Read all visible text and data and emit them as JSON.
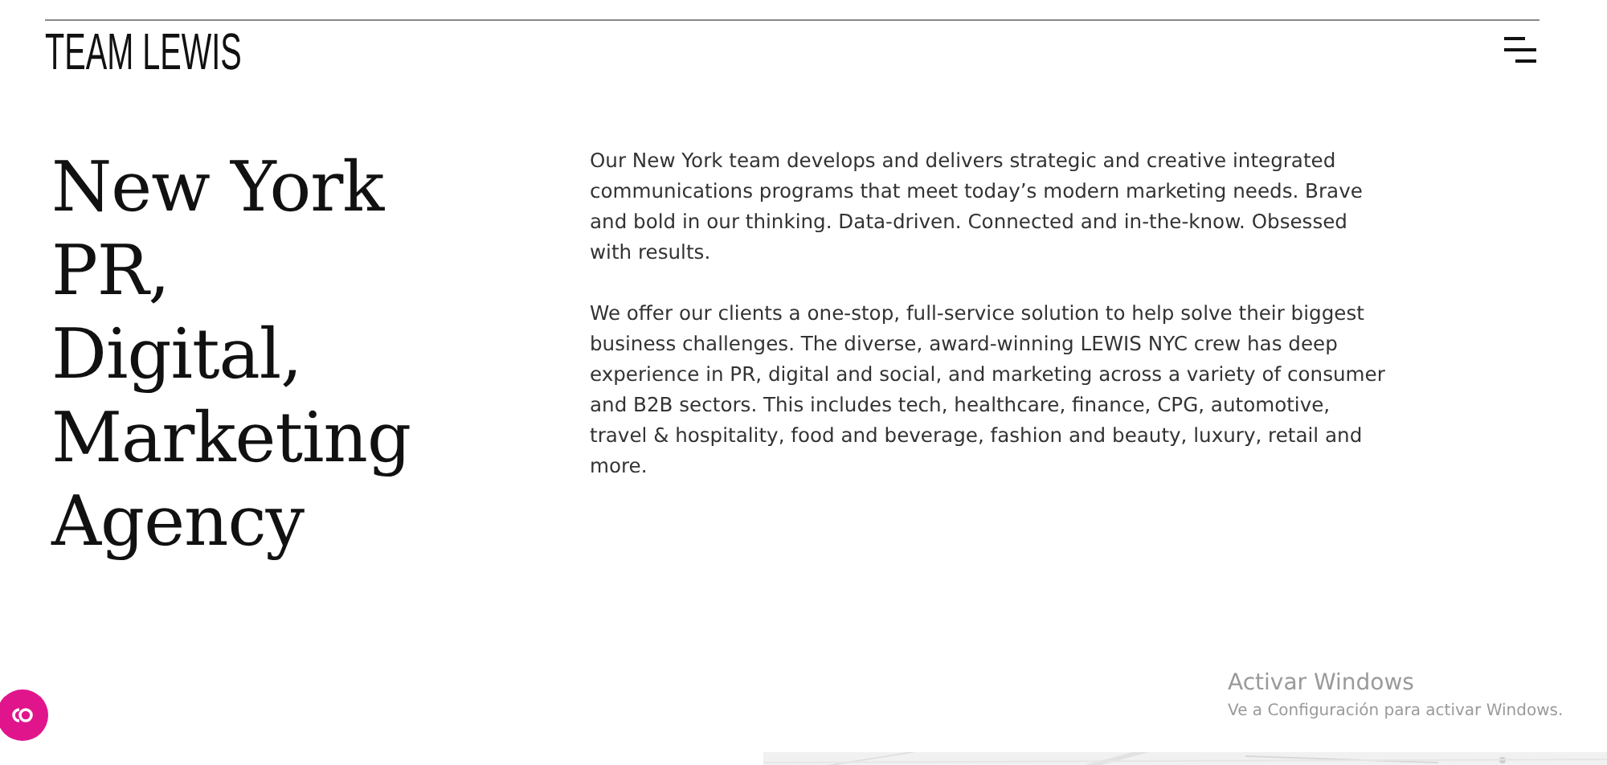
{
  "header": {
    "logo": "TEAM LEWIS"
  },
  "heading": {
    "lines": [
      "New York",
      "PR,",
      "Digital,",
      "Marketing",
      "Agency"
    ]
  },
  "paragraphs": [
    "Our New York team develops and delivers strategic and creative integrated communications programs that meet today’s modern marketing needs. Brave and bold in our thinking. Data-driven. Connected and in-the-know. Obsessed with results.",
    "We offer our clients a one-stop, full-service solution to help solve their biggest business challenges. The diverse, award-winning LEWIS NYC crew has deep experience in PR, digital and social, and marketing across a variety of consumer and B2B sectors. This includes tech, healthcare, finance, CPG, automotive, travel & hospitality, food and beverage, fashion and beauty, luxury, retail and more."
  ],
  "windows_notice": {
    "title": "Activar Windows",
    "text": "Ve a Configuración para activar Windows."
  }
}
